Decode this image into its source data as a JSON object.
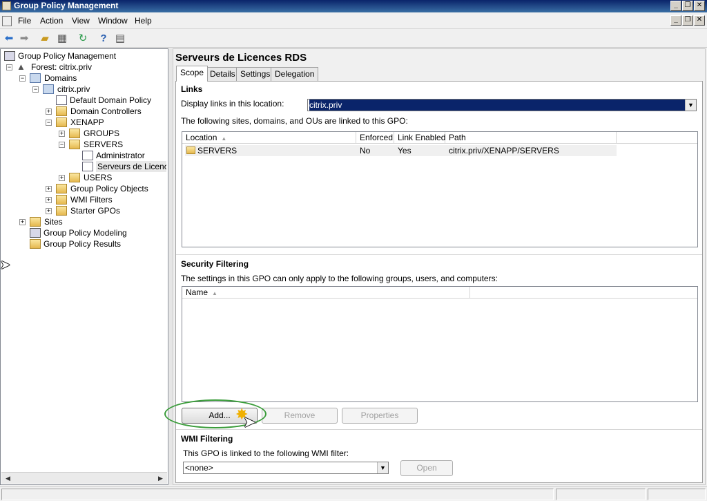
{
  "window": {
    "title": "Group Policy Management"
  },
  "menu": [
    "File",
    "Action",
    "View",
    "Window",
    "Help"
  ],
  "toolbar": [
    "back-icon",
    "forward-icon",
    "up-folder-icon",
    "show-hide-tree-icon",
    "refresh-icon",
    "help-icon",
    "properties-icon"
  ],
  "tree": {
    "items": [
      {
        "label": "Group Policy Management"
      },
      {
        "label": "Forest: citrix.priv"
      },
      {
        "label": "Domains"
      },
      {
        "label": "citrix.priv"
      },
      {
        "label": "Default Domain Policy"
      },
      {
        "label": "Domain Controllers"
      },
      {
        "label": "XENAPP"
      },
      {
        "label": "GROUPS"
      },
      {
        "label": "SERVERS"
      },
      {
        "label": "Administrator"
      },
      {
        "label": "Serveurs de Licences RDS"
      },
      {
        "label": "USERS"
      },
      {
        "label": "Group Policy Objects"
      },
      {
        "label": "WMI Filters"
      },
      {
        "label": "Starter GPOs"
      },
      {
        "label": "Sites"
      },
      {
        "label": "Group Policy Modeling"
      },
      {
        "label": "Group Policy Results"
      }
    ]
  },
  "details": {
    "title": "Serveurs de Licences RDS",
    "tabs": [
      "Scope",
      "Details",
      "Settings",
      "Delegation"
    ],
    "active_tab": "Scope",
    "links": {
      "heading": "Links",
      "display_label": "Display links in this location:",
      "location_value": "citrix.priv",
      "list_caption": "The following sites, domains, and OUs are linked to this GPO:",
      "columns": [
        "Location",
        "Enforced",
        "Link Enabled",
        "Path"
      ],
      "rows": [
        {
          "location": "SERVERS",
          "enforced": "No",
          "link_enabled": "Yes",
          "path": "citrix.priv/XENAPP/SERVERS"
        }
      ]
    },
    "security": {
      "heading": "Security Filtering",
      "caption": "The settings in this GPO can only apply to the following groups, users, and computers:",
      "columns": [
        "Name"
      ],
      "add_label": "Add...",
      "remove_label": "Remove",
      "properties_label": "Properties"
    },
    "wmi": {
      "heading": "WMI Filtering",
      "caption": "This GPO is linked to the following WMI filter:",
      "filter_value": "<none>",
      "open_label": "Open"
    }
  },
  "colors": {
    "titlebar": "#0a246a",
    "selection": "#0a246a",
    "highlight_ring": "#3a9c3a"
  }
}
